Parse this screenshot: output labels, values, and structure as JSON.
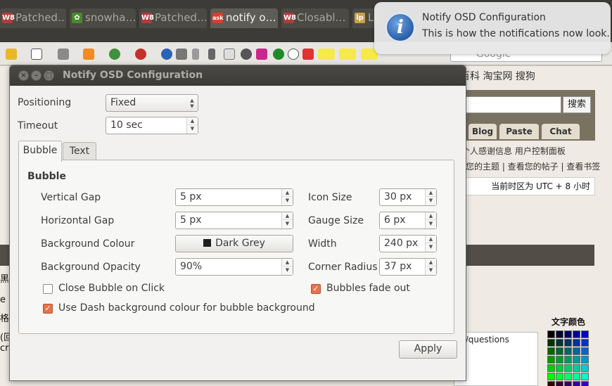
{
  "browser": {
    "tabs": [
      {
        "label": "Patched…",
        "fav": "W8",
        "fav_color": "#b23b3b"
      },
      {
        "label": "snowha…",
        "fav": "✿",
        "fav_color": "#4a8a2c"
      },
      {
        "label": "Patched…",
        "fav": "W8",
        "fav_color": "#b23b3b"
      },
      {
        "label": "notify o…",
        "fav": "ask",
        "fav_color": "#d6402b"
      },
      {
        "label": "Closabl…",
        "fav": "W8",
        "fav_color": "#b23b3b"
      },
      {
        "label": "Le…",
        "fav": "lp",
        "fav_color": "#c9a04a"
      }
    ],
    "search_placeholder": "Google",
    "bookmarks": "事百科  淘宝网  搜狗",
    "site": {
      "search_button": "搜索",
      "nav_tabs": [
        "Blog",
        "Paste",
        "Chat"
      ],
      "links_line1": "个人感谢信息  用户控制面板",
      "links_line2": "您的主题 | 查看您的帖子 | 查看书签",
      "timezone": "当前时区为 UTC + 8 小时",
      "left_strip": [
        "黑",
        "e",
        "格",
        "(回",
        "cre"
      ],
      "url_snippet": "m/questions",
      "color_label": "文字颜色"
    }
  },
  "notification": {
    "icon": "info-icon",
    "title": "Notify OSD Configuration",
    "body": "This is how the notifications now look."
  },
  "dialog": {
    "title": "Notify OSD Configuration",
    "positioning": {
      "label": "Positioning",
      "value": "Fixed"
    },
    "timeout": {
      "label": "Timeout",
      "value": "10 sec"
    },
    "tabs": [
      "Bubble",
      "Text"
    ],
    "active_tab": "Bubble",
    "bubble": {
      "section_title": "Bubble",
      "vertical_gap": {
        "label": "Vertical Gap",
        "value": "5 px"
      },
      "horizontal_gap": {
        "label": "Horizontal Gap",
        "value": "5 px"
      },
      "background_colour": {
        "label": "Background Colour",
        "value": "Dark Grey",
        "swatch": "#1e1e1e"
      },
      "background_opacity": {
        "label": "Background Opacity",
        "value": "90%"
      },
      "icon_size": {
        "label": "Icon Size",
        "value": "30 px"
      },
      "gauge_size": {
        "label": "Gauge Size",
        "value": "6 px"
      },
      "width": {
        "label": "Width",
        "value": "240 px"
      },
      "corner_radius": {
        "label": "Corner Radius",
        "value": "37 px"
      },
      "close_on_click": {
        "label": "Close Bubble on Click",
        "checked": false
      },
      "fade_out": {
        "label": "Bubbles fade out",
        "checked": true
      },
      "use_dash_bg": {
        "label": "Use Dash background colour for bubble background",
        "checked": true
      }
    },
    "apply_label": "Apply"
  },
  "colors": {
    "accent": "#e8724a",
    "titlebar": "#3c3b37",
    "dialog_bg": "#f2f1f0"
  }
}
